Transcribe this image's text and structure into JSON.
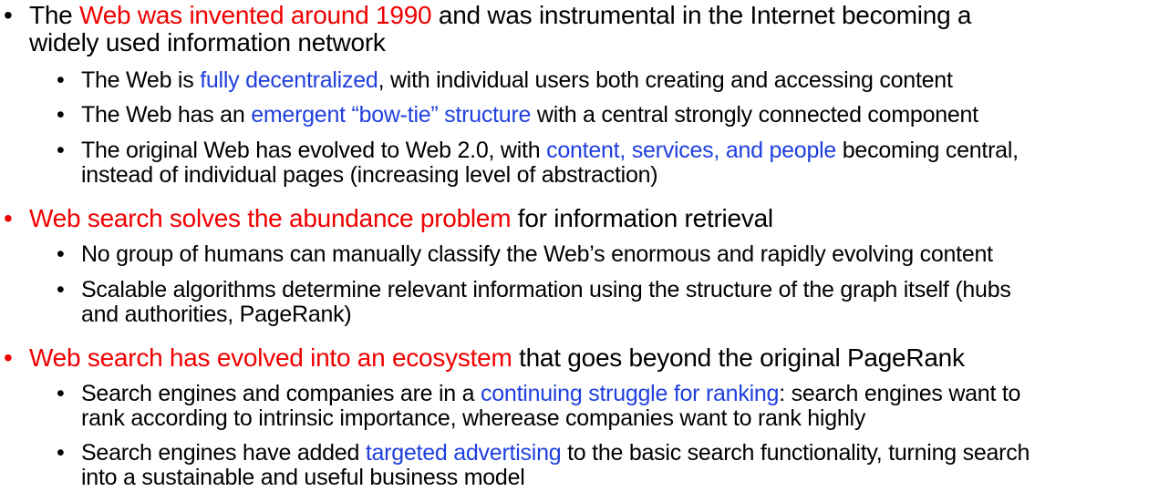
{
  "bullet_symbol": "•",
  "items": [
    {
      "level": 1,
      "marker_color": "#000000",
      "lines": [
        [
          {
            "text": "The ",
            "color": "#000000"
          },
          {
            "text": "Web was invented around 1990",
            "color": "#f00000"
          },
          {
            "text": " and was instrumental in the Internet becoming a",
            "color": "#000000"
          }
        ],
        [
          {
            "text": "widely used information network",
            "color": "#000000"
          }
        ]
      ]
    },
    {
      "level": 2,
      "marker_color": "#000000",
      "lines": [
        [
          {
            "text": "The Web is ",
            "color": "#000000"
          },
          {
            "text": "fully decentralized",
            "color": "#1f3fdd"
          },
          {
            "text": ", with individual users both creating and accessing content",
            "color": "#000000"
          }
        ]
      ]
    },
    {
      "level": 2,
      "marker_color": "#000000",
      "lines": [
        [
          {
            "text": "The Web has an ",
            "color": "#000000"
          },
          {
            "text": "emergent “bow-tie” structure",
            "color": "#1f3fdd"
          },
          {
            "text": " with a central strongly connected component",
            "color": "#000000"
          }
        ]
      ]
    },
    {
      "level": 2,
      "marker_color": "#000000",
      "lines": [
        [
          {
            "text": "The original Web has evolved to Web 2.0, with ",
            "color": "#000000"
          },
          {
            "text": "content, services, and people",
            "color": "#1f3fdd"
          },
          {
            "text": " becoming central,",
            "color": "#000000"
          }
        ],
        [
          {
            "text": "instead of individual pages (increasing level of abstraction)",
            "color": "#000000"
          }
        ]
      ]
    },
    {
      "level": 1,
      "marker_color": "#f00000",
      "lines": [
        [
          {
            "text": "Web search solves the abundance problem",
            "color": "#f00000"
          },
          {
            "text": " for information retrieval",
            "color": "#000000"
          }
        ]
      ]
    },
    {
      "level": 2,
      "marker_color": "#000000",
      "lines": [
        [
          {
            "text": "No group of humans can manually classify the Web’s enormous and rapidly evolving content",
            "color": "#000000"
          }
        ]
      ]
    },
    {
      "level": 2,
      "marker_color": "#000000",
      "lines": [
        [
          {
            "text": "Scalable algorithms determine relevant information using the structure of the graph itself (hubs",
            "color": "#000000"
          }
        ],
        [
          {
            "text": "and authorities, PageRank)",
            "color": "#000000"
          }
        ]
      ]
    },
    {
      "level": 1,
      "marker_color": "#f00000",
      "lines": [
        [
          {
            "text": "Web search has evolved into an ecosystem",
            "color": "#f00000"
          },
          {
            "text": " that goes beyond the original PageRank",
            "color": "#000000"
          }
        ]
      ]
    },
    {
      "level": 2,
      "marker_color": "#000000",
      "lines": [
        [
          {
            "text": "Search engines and companies are in a ",
            "color": "#000000"
          },
          {
            "text": "continuing struggle for ranking",
            "color": "#1f3fdd"
          },
          {
            "text": ": search engines want to",
            "color": "#000000"
          }
        ],
        [
          {
            "text": "rank according to intrinsic importance, wherease companies want to rank highly",
            "color": "#000000"
          }
        ]
      ]
    },
    {
      "level": 2,
      "marker_color": "#000000",
      "lines": [
        [
          {
            "text": "Search engines have added ",
            "color": "#000000"
          },
          {
            "text": "targeted advertising",
            "color": "#1f3fdd"
          },
          {
            "text": " to the basic search functionality, turning search",
            "color": "#000000"
          }
        ],
        [
          {
            "text": "into a sustainable and useful business model",
            "color": "#000000"
          }
        ]
      ]
    }
  ]
}
